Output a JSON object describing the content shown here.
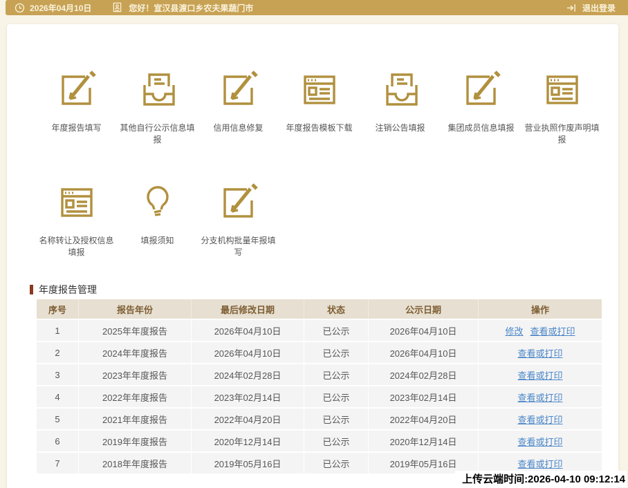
{
  "topbar": {
    "date": "2026年04月10日",
    "greeting": "您好！宣汉县渡口乡农夫果蔬门市",
    "logout_label": "退出登录"
  },
  "menu": {
    "items": [
      {
        "label": "年度报告填写",
        "icon": "edit-icon"
      },
      {
        "label": "其他自行公示信息填报",
        "icon": "inbox-icon"
      },
      {
        "label": "信用信息修复",
        "icon": "edit-icon"
      },
      {
        "label": "年度报告模板下载",
        "icon": "webpage-icon"
      },
      {
        "label": "注销公告填报",
        "icon": "inbox-icon"
      },
      {
        "label": "集团成员信息填报",
        "icon": "edit-icon"
      },
      {
        "label": "营业执照作废声明填报",
        "icon": "webpage-icon"
      },
      {
        "label": "名称转让及授权信息填报",
        "icon": "webpage-icon"
      },
      {
        "label": "填报须知",
        "icon": "bulb-icon"
      },
      {
        "label": "分支机构批量年报填写",
        "icon": "edit-icon"
      }
    ]
  },
  "section": {
    "title": "年度报告管理"
  },
  "table": {
    "headers": [
      "序号",
      "报告年份",
      "最后修改日期",
      "状态",
      "公示日期",
      "操作"
    ],
    "rows": [
      {
        "no": "1",
        "year": "2025年年度报告",
        "modified": "2026年04月10日",
        "status": "已公示",
        "published": "2026年04月10日",
        "links": [
          "修改",
          "查看或打印"
        ]
      },
      {
        "no": "2",
        "year": "2024年年度报告",
        "modified": "2026年04月10日",
        "status": "已公示",
        "published": "2026年04月10日",
        "links": [
          "查看或打印"
        ]
      },
      {
        "no": "3",
        "year": "2023年年度报告",
        "modified": "2024年02月28日",
        "status": "已公示",
        "published": "2024年02月28日",
        "links": [
          "查看或打印"
        ]
      },
      {
        "no": "4",
        "year": "2022年年度报告",
        "modified": "2023年02月14日",
        "status": "已公示",
        "published": "2023年02月14日",
        "links": [
          "查看或打印"
        ]
      },
      {
        "no": "5",
        "year": "2021年年度报告",
        "modified": "2022年04月20日",
        "status": "已公示",
        "published": "2022年04月20日",
        "links": [
          "查看或打印"
        ]
      },
      {
        "no": "6",
        "year": "2019年年度报告",
        "modified": "2020年12月14日",
        "status": "已公示",
        "published": "2020年12月14日",
        "links": [
          "查看或打印"
        ]
      },
      {
        "no": "7",
        "year": "2018年年度报告",
        "modified": "2019年05月16日",
        "status": "已公示",
        "published": "2019年05月16日",
        "links": [
          "查看或打印"
        ]
      }
    ]
  },
  "footer": {
    "upload_time": "上传云端时间:2026-04-10 09:12:14"
  },
  "colors": {
    "topbar_gold": "#c7a254",
    "icon_gold": "#b1903e",
    "page_bg": "#f8f4e7",
    "section_bar": "#8b3a21",
    "table_header_bg": "#e7dfd1",
    "table_header_text": "#7d5e33",
    "row_bg": "#f4f4f4",
    "link_blue": "#4a86c8"
  }
}
